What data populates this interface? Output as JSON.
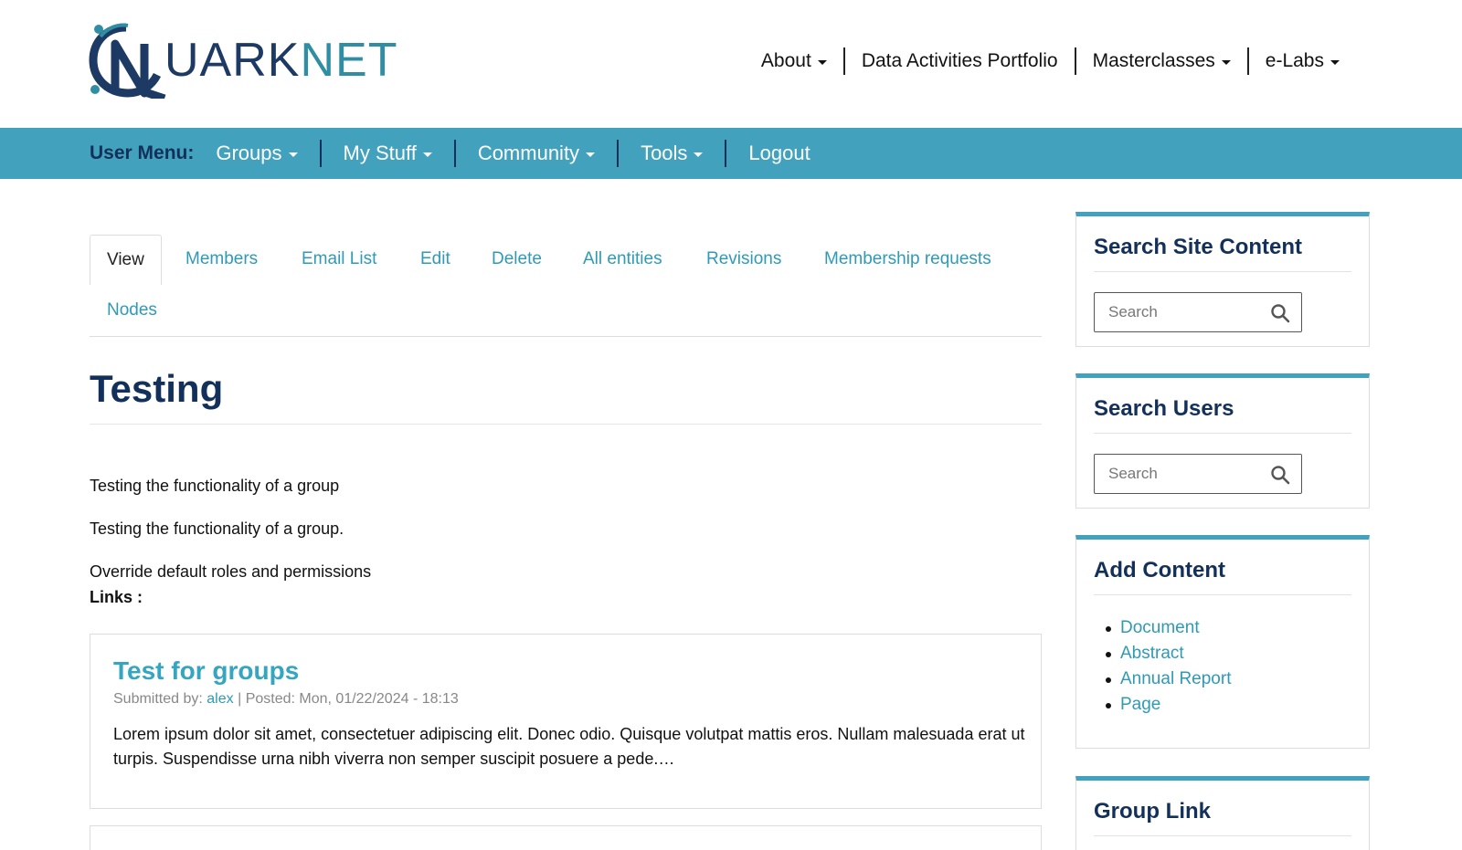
{
  "brand": {
    "logo_part1": "UARK",
    "logo_part2": "NET",
    "logo_alt": "QuarkNet"
  },
  "top_nav": [
    {
      "label": "About",
      "dropdown": true
    },
    {
      "label": "Data Activities Portfolio",
      "dropdown": false
    },
    {
      "label": "Masterclasses",
      "dropdown": true
    },
    {
      "label": "e-Labs",
      "dropdown": true
    }
  ],
  "user_menu": {
    "label": "User Menu:",
    "items": [
      {
        "label": "Groups",
        "dropdown": true
      },
      {
        "label": "My Stuff",
        "dropdown": true
      },
      {
        "label": "Community",
        "dropdown": true
      },
      {
        "label": "Tools",
        "dropdown": true
      },
      {
        "label": "Logout",
        "dropdown": false
      }
    ]
  },
  "tabs": [
    "View",
    "Members",
    "Email List",
    "Edit",
    "Delete",
    "All entities",
    "Revisions",
    "Membership requests",
    "Nodes"
  ],
  "page": {
    "title": "Testing",
    "lines": [
      "Testing the functionality of a group",
      "Testing the functionality of a group.",
      "Override default roles and permissions"
    ],
    "links_label": "Links :"
  },
  "post": {
    "title": "Test for groups",
    "submitted_label": "Submitted by:",
    "author": "alex",
    "posted_label": "| Posted: Mon, 01/22/2024 - 18:13",
    "body": "Lorem ipsum dolor sit amet, consectetuer adipiscing elit. Donec odio. Quisque volutpat mattis eros. Nullam malesuada erat ut turpis. Suspendisse urna nibh viverra non semper suscipit posuere a pede.…"
  },
  "sidebar": {
    "search_site": {
      "title": "Search Site Content",
      "placeholder": "Search"
    },
    "search_users": {
      "title": "Search Users",
      "placeholder": "Search"
    },
    "add_content": {
      "title": "Add Content",
      "items": [
        "Document",
        "Abstract",
        "Annual Report",
        "Page"
      ]
    },
    "group_link": {
      "title": "Group Link"
    }
  },
  "colors": {
    "brand_navy": "#13305a",
    "accent_teal": "#42a1bd",
    "link": "#2f9ab6"
  }
}
